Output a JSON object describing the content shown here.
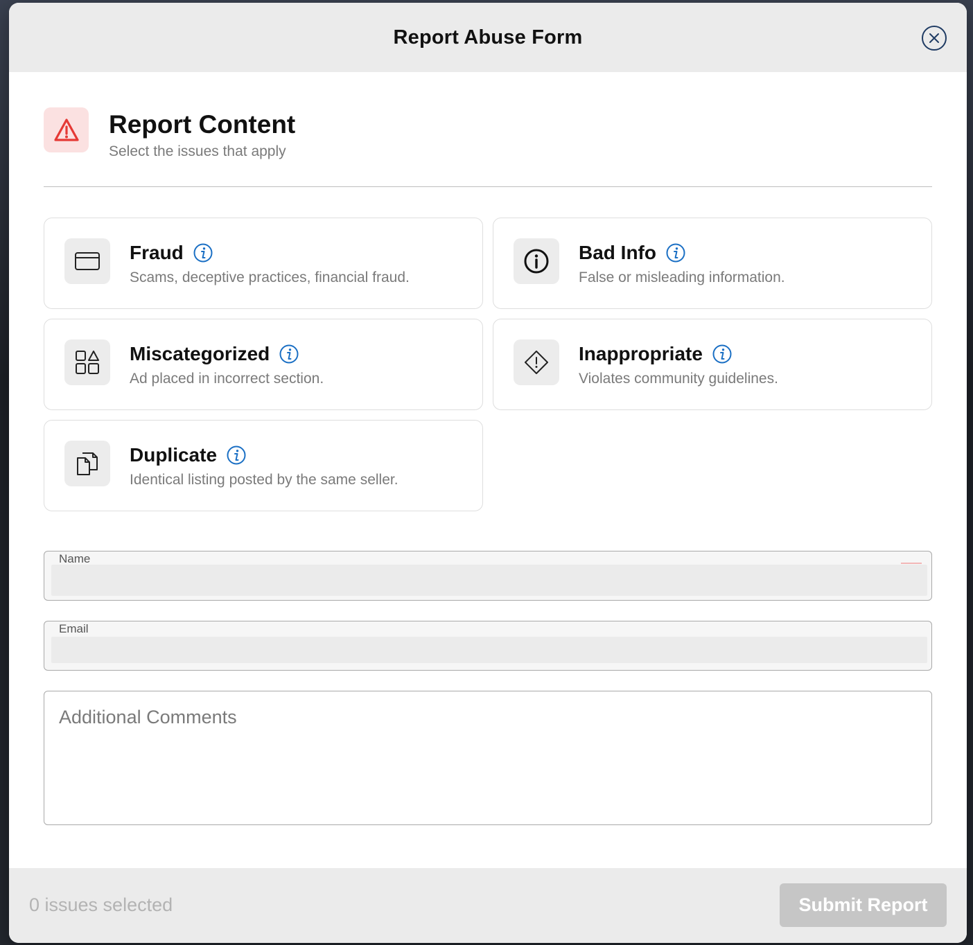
{
  "modal": {
    "title": "Report Abuse Form",
    "close_label": "close"
  },
  "section": {
    "title": "Report Content",
    "subtitle": "Select the issues that apply",
    "icon": "warning-triangle-icon"
  },
  "issues": [
    {
      "title": "Fraud",
      "description": "Scams, deceptive practices, financial fraud.",
      "icon": "credit-card-icon"
    },
    {
      "title": "Bad Info",
      "description": "False or misleading information.",
      "icon": "info-circle-icon"
    },
    {
      "title": "Miscategorized",
      "description": "Ad placed in incorrect section.",
      "icon": "categories-icon"
    },
    {
      "title": "Inappropriate",
      "description": "Violates community guidelines.",
      "icon": "alert-diamond-icon"
    },
    {
      "title": "Duplicate",
      "description": "Identical listing posted by the same seller.",
      "icon": "copy-icon"
    }
  ],
  "form": {
    "name_label": "Name",
    "name_value": "",
    "email_label": "Email",
    "email_value": "",
    "comments_placeholder": "Additional Comments",
    "comments_value": ""
  },
  "footer": {
    "selected_count_text": "0 issues selected",
    "submit_label": "Submit Report"
  },
  "colors": {
    "accent_blue": "#1a6fc4",
    "warning_red": "#e53935",
    "header_bg": "#ebebeb",
    "disabled_button": "#c6c6c6"
  }
}
